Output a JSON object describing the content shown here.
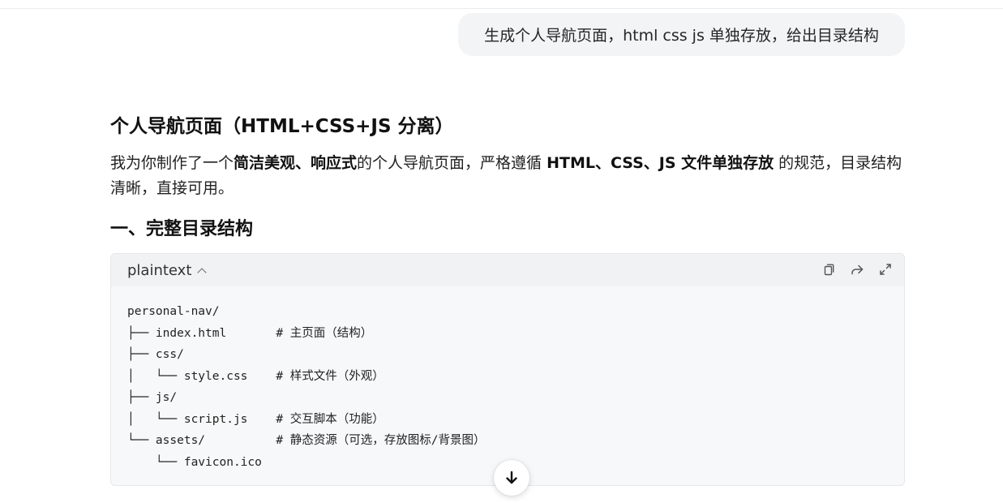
{
  "user_message": "生成个人导航页面，html css js  单独存放，给出目录结构",
  "answer": {
    "title": "个人导航页面（HTML+CSS+JS 分离）",
    "intro": {
      "p1": "我为你制作了一个",
      "b1": "简洁美观、响应式",
      "p2": "的个人导航页面，严格遵循 ",
      "b2": "HTML、CSS、JS 文件单独存放",
      "p3": " 的规范，目录结构清晰，直接可用。"
    },
    "section1_title": "一、完整目录结构"
  },
  "code_block": {
    "language": "plaintext",
    "icons": [
      "copy-icon",
      "share-icon",
      "expand-icon"
    ],
    "lines": [
      "personal-nav/",
      "├── index.html       # 主页面（结构）",
      "├── css/",
      "│   └── style.css    # 样式文件（外观）",
      "├── js/",
      "│   └── script.js    # 交互脚本（功能）",
      "└── assets/          # 静态资源（可选，存放图标/背景图）",
      "    └── favicon.ico"
    ]
  },
  "scroll_button": {
    "icon": "arrow-down-icon"
  }
}
